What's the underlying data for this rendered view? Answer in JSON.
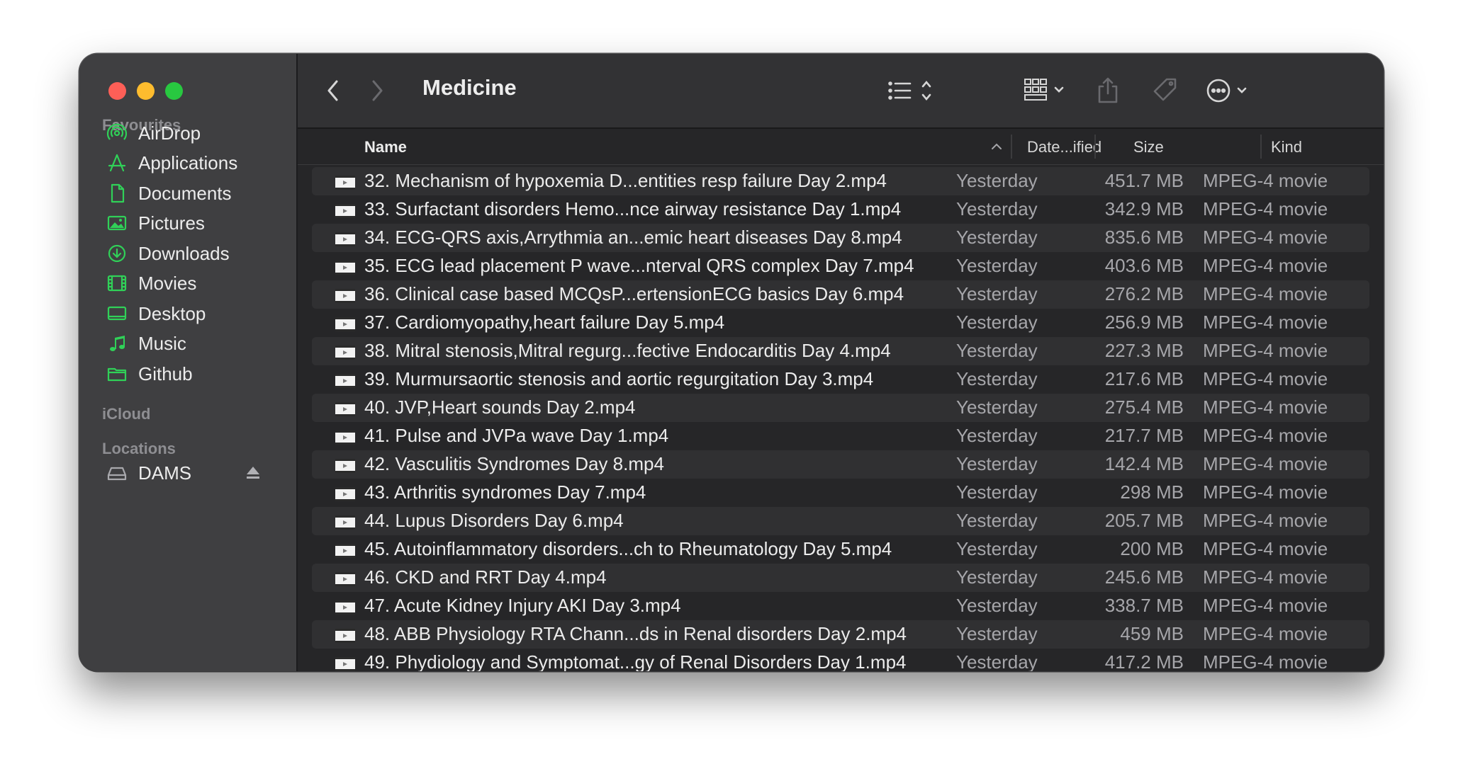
{
  "window": {
    "title": "Medicine"
  },
  "sidebar": {
    "favourites_heading": "Favourites",
    "favourites": [
      {
        "label": "AirDrop",
        "icon": "airdrop-icon"
      },
      {
        "label": "Applications",
        "icon": "applications-icon"
      },
      {
        "label": "Documents",
        "icon": "document-icon"
      },
      {
        "label": "Pictures",
        "icon": "pictures-icon"
      },
      {
        "label": "Downloads",
        "icon": "downloads-icon"
      },
      {
        "label": "Movies",
        "icon": "movies-icon"
      },
      {
        "label": "Desktop",
        "icon": "desktop-icon"
      },
      {
        "label": "Music",
        "icon": "music-icon"
      },
      {
        "label": "Github",
        "icon": "folder-icon"
      }
    ],
    "icloud_heading": "iCloud",
    "locations_heading": "Locations",
    "locations": [
      {
        "label": "DAMS",
        "icon": "drive-icon"
      }
    ]
  },
  "columns": {
    "name": "Name",
    "date": "Date...ified",
    "size": "Size",
    "kind": "Kind"
  },
  "files": [
    {
      "name": "32. Mechanism of hypoxemia D...entities  resp failure   Day 2.mp4",
      "date": "Yesterday",
      "size": "451.7 MB",
      "kind": "MPEG-4 movie"
    },
    {
      "name": "33. Surfactant disorders Hemo...nce  airway resistance Day 1.mp4",
      "date": "Yesterday",
      "size": "342.9 MB",
      "kind": "MPEG-4 movie"
    },
    {
      "name": "34. ECG-QRS axis,Arrythmia an...emic heart diseases Day 8.mp4",
      "date": "Yesterday",
      "size": "835.6 MB",
      "kind": "MPEG-4 movie"
    },
    {
      "name": "35. ECG lead placement P wave...nterval QRS complex Day 7.mp4",
      "date": "Yesterday",
      "size": "403.6 MB",
      "kind": "MPEG-4 movie"
    },
    {
      "name": "36. Clinical case based MCQsP...ertensionECG basics Day 6.mp4",
      "date": "Yesterday",
      "size": "276.2 MB",
      "kind": "MPEG-4 movie"
    },
    {
      "name": "37. Cardiomyopathy,heart failure Day 5.mp4",
      "date": "Yesterday",
      "size": "256.9 MB",
      "kind": "MPEG-4 movie"
    },
    {
      "name": "38. Mitral stenosis,Mitral regurg...fective Endocarditis Day 4.mp4",
      "date": "Yesterday",
      "size": "227.3 MB",
      "kind": "MPEG-4 movie"
    },
    {
      "name": "39. Murmursaortic stenosis and aortic regurgitation Day 3.mp4",
      "date": "Yesterday",
      "size": "217.6 MB",
      "kind": "MPEG-4 movie"
    },
    {
      "name": "40. JVP,Heart sounds Day 2.mp4",
      "date": "Yesterday",
      "size": "275.4 MB",
      "kind": "MPEG-4 movie"
    },
    {
      "name": "41. Pulse and JVPa wave Day 1.mp4",
      "date": "Yesterday",
      "size": "217.7 MB",
      "kind": "MPEG-4 movie"
    },
    {
      "name": "42. Vasculitis Syndromes Day 8.mp4",
      "date": "Yesterday",
      "size": "142.4 MB",
      "kind": "MPEG-4 movie"
    },
    {
      "name": "43. Arthritis syndromes Day 7.mp4",
      "date": "Yesterday",
      "size": "298 MB",
      "kind": "MPEG-4 movie"
    },
    {
      "name": "44. Lupus Disorders Day 6.mp4",
      "date": "Yesterday",
      "size": "205.7 MB",
      "kind": "MPEG-4 movie"
    },
    {
      "name": "45. Autoinflammatory disorders...ch to Rheumatology Day 5.mp4",
      "date": "Yesterday",
      "size": "200 MB",
      "kind": "MPEG-4 movie"
    },
    {
      "name": "46. CKD and RRT Day 4.mp4",
      "date": "Yesterday",
      "size": "245.6 MB",
      "kind": "MPEG-4 movie"
    },
    {
      "name": "47. Acute Kidney Injury AKI Day 3.mp4",
      "date": "Yesterday",
      "size": "338.7 MB",
      "kind": "MPEG-4 movie"
    },
    {
      "name": "48. ABB Physiology RTA  Chann...ds in Renal disorders Day 2.mp4",
      "date": "Yesterday",
      "size": "459 MB",
      "kind": "MPEG-4 movie"
    },
    {
      "name": "49. Phydiology and Symptomat...gy of Renal Disorders Day 1.mp4",
      "date": "Yesterday",
      "size": "417.2 MB",
      "kind": "MPEG-4 movie"
    }
  ],
  "colors": {
    "accent": "#30d158",
    "close": "#fe5f57",
    "minimize": "#febc2e",
    "maximize": "#28c840"
  }
}
